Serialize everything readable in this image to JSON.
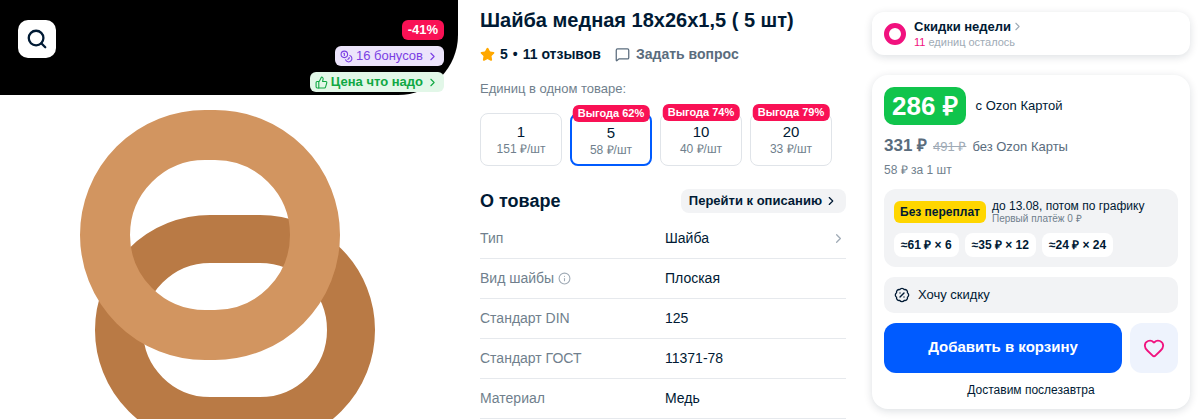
{
  "product_image": {
    "badges": {
      "discount": "-41%",
      "bonus": "16 бонусов",
      "price_tag": "Цена что надо"
    }
  },
  "product": {
    "title": "Шайба медная 18x26x1,5 ( 5 шт)",
    "rating": {
      "value": "5",
      "separator": "•",
      "reviews": "11 отзывов",
      "stars": 1
    },
    "ask": "Задать вопрос"
  },
  "quantity": {
    "label": "Единиц в одном товаре:",
    "options": [
      {
        "count": "1",
        "price": "151 ₽/шт",
        "badge": null,
        "selected": false
      },
      {
        "count": "5",
        "price": "58 ₽/шт",
        "badge": "Выгода 62%",
        "selected": true
      },
      {
        "count": "10",
        "price": "40 ₽/шт",
        "badge": "Выгода 74%",
        "selected": false
      },
      {
        "count": "20",
        "price": "33 ₽/шт",
        "badge": "Выгода 79%",
        "selected": false
      }
    ]
  },
  "about": {
    "title": "О товаре",
    "link": "Перейти к описанию",
    "rows": [
      {
        "label": "Тип",
        "value": "Шайба",
        "info": false,
        "link": true
      },
      {
        "label": "Вид шайбы",
        "value": "Плоская",
        "info": true,
        "link": false
      },
      {
        "label": "Стандарт DIN",
        "value": "125",
        "info": false,
        "link": false
      },
      {
        "label": "Стандарт ГОСТ",
        "value": "11371-78",
        "info": false,
        "link": false
      },
      {
        "label": "Материал",
        "value": "Медь",
        "info": false,
        "link": false
      }
    ]
  },
  "promo": {
    "title": "Скидки недели",
    "count": "11",
    "caption": "единиц осталось"
  },
  "price": {
    "card_price": "286 ₽",
    "card_label": "с Ozon Картой",
    "price": "331 ₽",
    "old_price": "491 ₽",
    "no_card_label": "без Ozon Карты",
    "unit_price": "58 ₽ за 1 шт"
  },
  "installment": {
    "badge": "Без переплат",
    "text": "до 13.08, потом по графику",
    "first": "Первый платёж 0 ₽",
    "plans": [
      "≈61 ₽ × 6",
      "≈35 ₽ × 12",
      "≈24 ₽ × 24"
    ]
  },
  "wish": "Хочу скидку",
  "cart_button": "Добавить в корзину",
  "delivery": "Доставим послезавтра"
}
